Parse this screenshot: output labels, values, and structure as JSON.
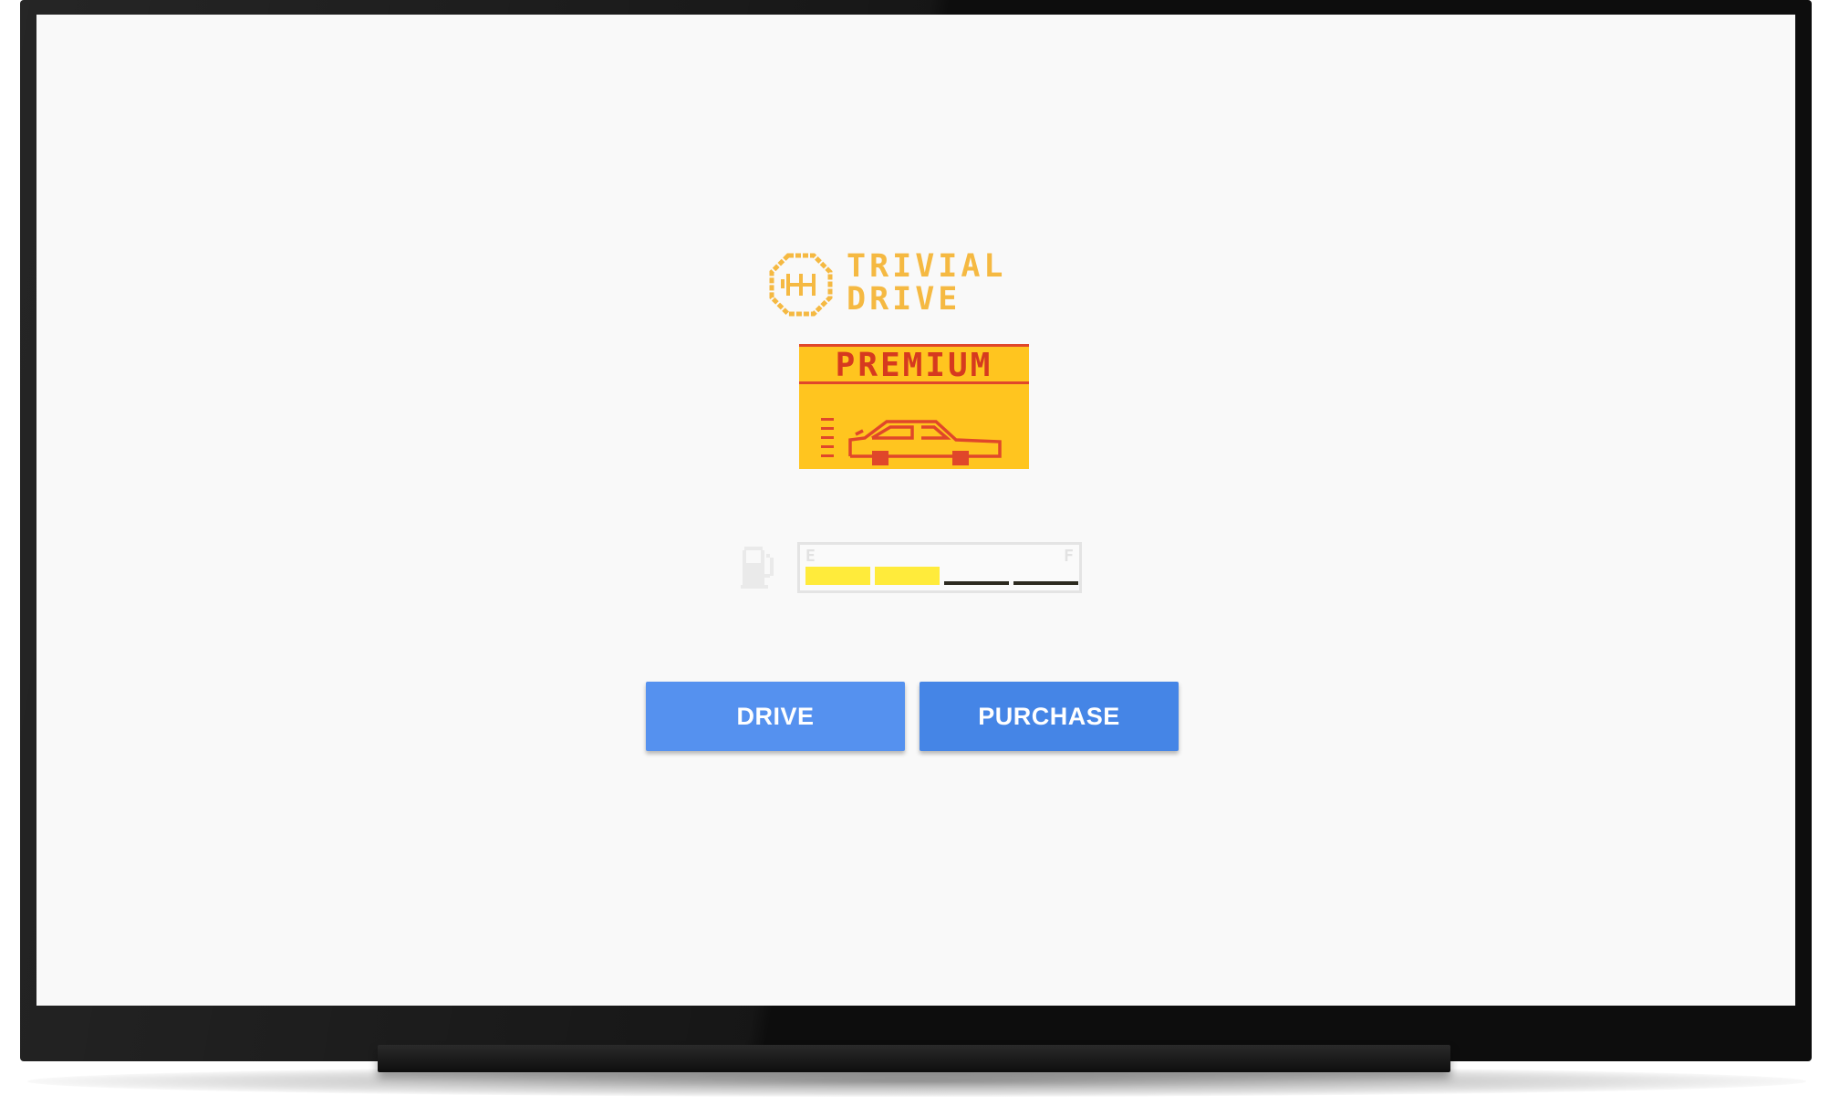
{
  "app": {
    "logo_text_line1": "TRIVIAL",
    "logo_text_line2": "DRIVE",
    "premium_label": "PREMIUM"
  },
  "gauge": {
    "empty_label": "E",
    "full_label": "F",
    "segments_total": 4,
    "segments_filled": 2
  },
  "buttons": {
    "drive_label": "DRIVE",
    "purchase_label": "PURCHASE"
  },
  "colors": {
    "logo_orange": "#f5b942",
    "premium_yellow": "#ffc51f",
    "premium_red": "#d63a1f",
    "gauge_fill": "#ffeb3b",
    "drive_button": "#5591ef",
    "purchase_button": "#4585e6"
  },
  "icons": {
    "logo": "gear-shift-icon",
    "car": "car-icon",
    "fuel": "fuel-pump-icon"
  }
}
